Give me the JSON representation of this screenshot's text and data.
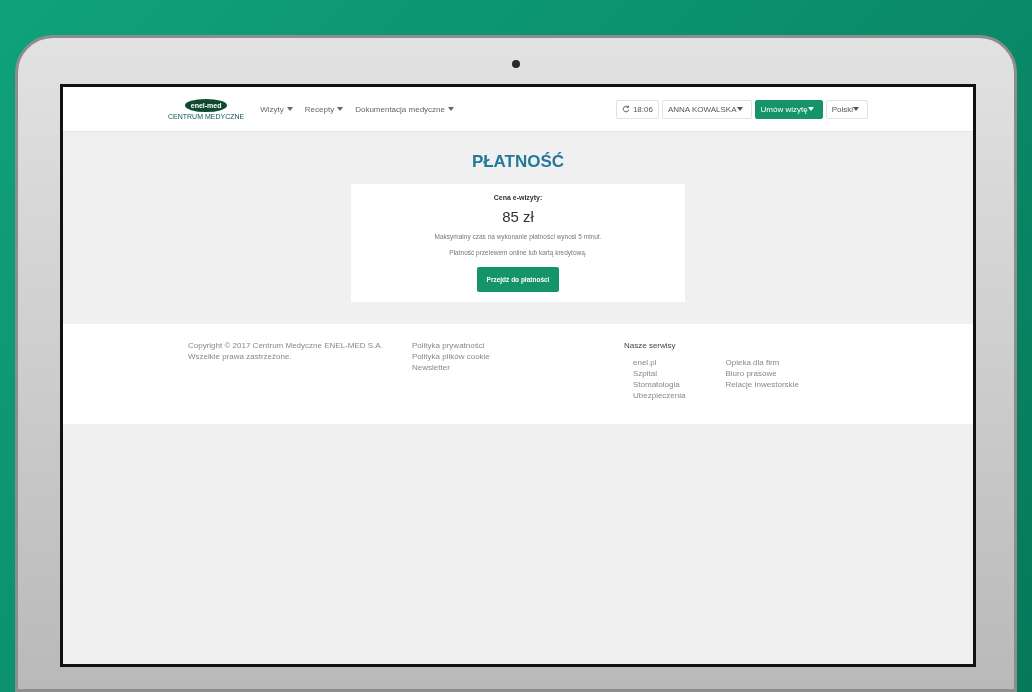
{
  "logo": {
    "name": "enel-med",
    "tagline": "CENTRUM MEDYCZNE"
  },
  "nav": [
    {
      "label": "Wizyty"
    },
    {
      "label": "Recepty"
    },
    {
      "label": "Dokumentacja medyczne"
    }
  ],
  "header_right": {
    "timer": "18:06",
    "user": "ANNA KOWALSKA",
    "book_button": "Umów wizytę",
    "language": "Polski"
  },
  "page_title": "PŁATNOŚĆ",
  "payment": {
    "price_label": "Cena e-wizyty:",
    "price": "85 zł",
    "notes": [
      "Maksymalny czas na wykonanie płatności wynosi 5 minut.",
      "Płatność przelewem online lub kartą kredytową."
    ],
    "pay_button": "Przejdź do płatności"
  },
  "footer": {
    "copyright": [
      "Copyright © 2017 Centrum Medyczne ENEL-MED S.A.",
      "Wszelkie prawa zastrzeżone."
    ],
    "links": [
      "Polityka prywatności",
      "Polityka plików cookie",
      "Newsletter"
    ],
    "services_title": "Nasze serwisy",
    "services_col_1": [
      "enel.pl",
      "Szpital",
      "Stomatologia",
      "Ubezpieczenia"
    ],
    "services_col_2": [
      "Opieka dla firm",
      "Biuro prasowe",
      "Relacje Inwestorskie"
    ]
  }
}
